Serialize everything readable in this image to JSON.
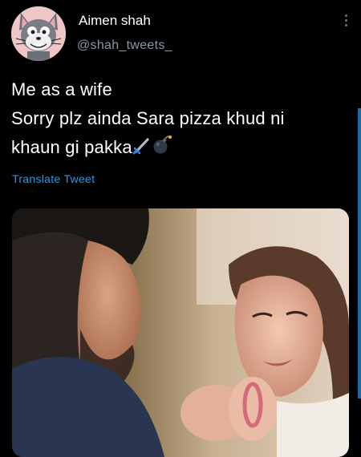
{
  "tweet": {
    "author": {
      "display_name": "Aimen shah",
      "handle": "@shah_tweets_",
      "avatar_icon": "tom-cat-avatar-icon"
    },
    "text_lines": [
      "Me as a wife",
      "Sorry plz ainda Sara pizza khud ni",
      "khaun gi pakka"
    ],
    "emojis": [
      "dagger-icon",
      "bomb-icon"
    ],
    "translate_label": "Translate Tweet",
    "more_icon": "more-vertical-icon",
    "media": {
      "type": "photo"
    }
  },
  "colors": {
    "background": "#000000",
    "text": "#ffffff",
    "secondary_text": "#8b98a5",
    "link": "#1d9bf0"
  }
}
